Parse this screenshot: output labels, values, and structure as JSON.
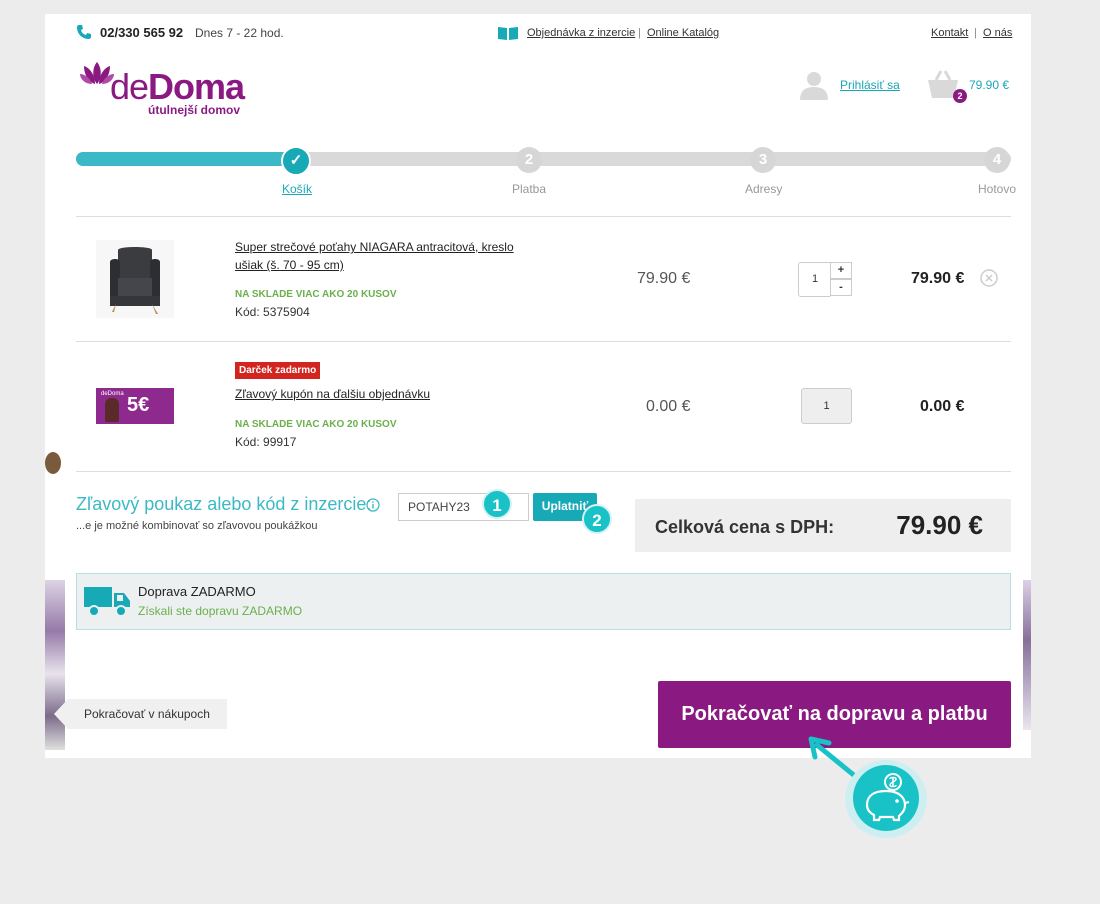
{
  "topbar": {
    "phone": "02/330 565 92",
    "hours": "Dnes 7 - 22 hod.",
    "order_link": "Objednávka z inzercie",
    "catalog_link": "Online Katalóg",
    "contact_link": "Kontakt",
    "about_link": "O nás",
    "separator": "|"
  },
  "logo": {
    "brand_light": "de",
    "brand_bold": "Doma",
    "tagline": "útulnejší domov"
  },
  "account": {
    "login_label": "Prihlásiť sa"
  },
  "cart": {
    "count": "2",
    "total": "79.90 €"
  },
  "steps": [
    {
      "number": "✓",
      "label": "Košík",
      "state": "done"
    },
    {
      "number": "2",
      "label": "Platba",
      "state": "todo"
    },
    {
      "number": "3",
      "label": "Adresy",
      "state": "todo"
    },
    {
      "number": "4",
      "label": "Hotovo",
      "state": "todo"
    }
  ],
  "progress_fraction": 0.24,
  "items": [
    {
      "name": "Super strečové poťahy NIAGARA antracitová, kreslo ušiak (š. 70 - 95 cm)",
      "stock": "NA SKLADE VIAC AKO 20 KUSOV",
      "code": "Kód: 5375904",
      "unit_price": "79.90 €",
      "qty": "1",
      "total": "79.90 €",
      "plus": "+",
      "minus": "-"
    },
    {
      "badge": "Darček zadarmo",
      "name": "Zľavový kupón na ďalšiu objednávku",
      "stock": "NA SKLADE VIAC AKO 20 KUSOV",
      "code": "Kód: 99917",
      "unit_price": "0.00 €",
      "qty": "1",
      "total": "0.00 €",
      "voucher_text": "5€",
      "voucher_brand": "deDoma"
    }
  ],
  "coupon": {
    "title": "Zľavový poukaz alebo kód z inzercie:",
    "note": "...e je možné kombinovať so zľavovou poukážkou",
    "value": "POTAHY23",
    "apply_label": "Uplatniť",
    "step1": "1",
    "step2": "2"
  },
  "total": {
    "label": "Celková cena s DPH:",
    "value": "79.90 €"
  },
  "shipping": {
    "title": "Doprava ZADARMO",
    "subtitle": "Získali ste dopravu ZADARMO"
  },
  "buttons": {
    "continue_shopping": "Pokračovať v nákupoch",
    "proceed": "Pokračovať na dopravu a platbu"
  },
  "colors": {
    "brand_purple": "#8a1a82",
    "accent_teal": "#18a9b6",
    "stock_green": "#6ab04c",
    "gift_red": "#d3251f"
  }
}
